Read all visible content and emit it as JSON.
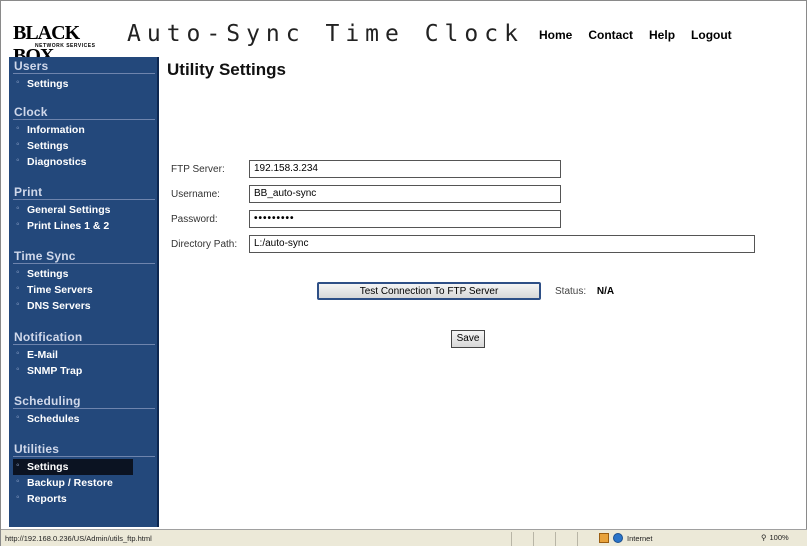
{
  "app": {
    "brand": "BLACK BOX",
    "brand_sub": "NETWORK SERVICES",
    "title": "Auto-Sync Time Clock"
  },
  "topnav": [
    "Home",
    "Contact",
    "Help",
    "Logout"
  ],
  "sidebar": {
    "users": {
      "title": "Users",
      "items": [
        "Settings"
      ]
    },
    "clock": {
      "title": "Clock",
      "items": [
        "Information",
        "Settings",
        "Diagnostics"
      ]
    },
    "print": {
      "title": "Print",
      "items": [
        "General Settings",
        "Print Lines 1 & 2"
      ]
    },
    "timesync": {
      "title": "Time Sync",
      "items": [
        "Settings",
        "Time Servers",
        "DNS Servers"
      ]
    },
    "notification": {
      "title": "Notification",
      "items": [
        "E-Mail",
        "SNMP Trap"
      ]
    },
    "scheduling": {
      "title": "Scheduling",
      "items": [
        "Schedules"
      ]
    },
    "utilities": {
      "title": "Utilities",
      "items": [
        "Settings",
        "Backup / Restore",
        "Reports"
      ]
    }
  },
  "main": {
    "page_title": "Utility Settings",
    "form": {
      "ftp_server_label": "FTP Server:",
      "ftp_server_value": "192.158.3.234",
      "username_label": "Username:",
      "username_value": "BB_auto-sync",
      "password_label": "Password:",
      "password_value": "•••••••••",
      "dirpath_label": "Directory Path:",
      "dirpath_value": "L:/auto-sync"
    },
    "test_button": "Test Connection To FTP Server",
    "status_label": "Status:",
    "status_value": "N/A",
    "save_button": "Save"
  },
  "statusbar": {
    "url": "http://192.168.0.236/US/Admin/utils_ftp.html",
    "zone": "Internet",
    "zoom": "100%"
  },
  "colors": {
    "sidebar_bg": "#23487b",
    "active_item_bg": "#0b1322",
    "test_button_border": "#2e4f86"
  }
}
